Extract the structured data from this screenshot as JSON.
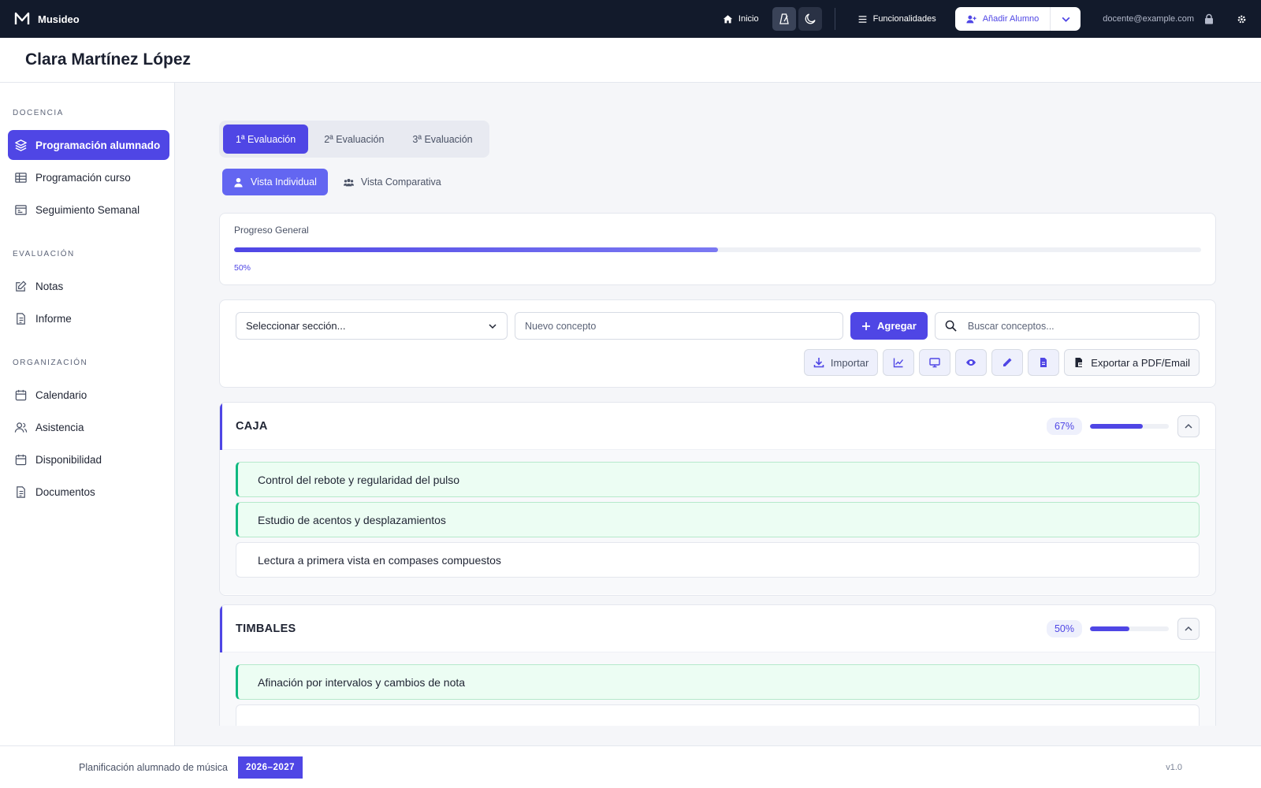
{
  "brand": {
    "name": "Musideo"
  },
  "topbar": {
    "home_label": "Inicio",
    "features_label": "Funcionalidades",
    "add_student_label": "Añadir Alumno",
    "user_email": "docente@example.com"
  },
  "page": {
    "title": "Clara Martínez López"
  },
  "sidebar": {
    "sections": [
      {
        "label": "DOCENCIA",
        "items": [
          {
            "label": "Programación alumnado",
            "icon": "layers-icon",
            "active": true
          },
          {
            "label": "Programación curso",
            "icon": "table-icon"
          },
          {
            "label": "Seguimiento Semanal",
            "icon": "calendar-week-icon"
          }
        ]
      },
      {
        "label": "EVALUACIÓN",
        "items": [
          {
            "label": "Notas",
            "icon": "edit-icon"
          },
          {
            "label": "Informe",
            "icon": "document-icon"
          }
        ]
      },
      {
        "label": "ORGANIZACIÓN",
        "items": [
          {
            "label": "Calendario",
            "icon": "calendar-icon"
          },
          {
            "label": "Asistencia",
            "icon": "users-icon"
          },
          {
            "label": "Disponibilidad",
            "icon": "calendar-icon"
          },
          {
            "label": "Documentos",
            "icon": "document-icon"
          }
        ]
      }
    ]
  },
  "eval_tabs": [
    "1ª Evaluación",
    "2ª Evaluación",
    "3ª Evaluación"
  ],
  "eval_tab_active": 0,
  "views": {
    "individual": "Vista Individual",
    "comparative": "Vista Comparativa"
  },
  "progress": {
    "label": "Progreso General",
    "value": 50,
    "value_text": "50%"
  },
  "toolbar": {
    "section_select": "Seleccionar sección...",
    "concept_placeholder": "Nuevo concepto",
    "add_label": "Agregar",
    "search_placeholder": "Buscar conceptos...",
    "import_label": "Importar",
    "export_label": "Exportar a PDF/Email"
  },
  "sections": [
    {
      "title": "CAJA",
      "pct": 67,
      "pct_text": "67%",
      "concepts": [
        {
          "label": "Control del rebote y regularidad del pulso",
          "done": true
        },
        {
          "label": "Estudio de acentos y desplazamientos",
          "done": true
        },
        {
          "label": "Lectura a primera vista en compases compuestos",
          "done": false
        }
      ]
    },
    {
      "title": "TIMBALES",
      "pct": 50,
      "pct_text": "50%",
      "concepts": [
        {
          "label": "Afinación por intervalos y cambios de nota",
          "done": true
        }
      ]
    }
  ],
  "footer": {
    "text": "Planificación alumnado de música",
    "year": "2026–2027",
    "version": "v1.0"
  },
  "colors": {
    "accent": "#4f46e5",
    "topbar": "#121a2b",
    "done": "#10b981"
  }
}
